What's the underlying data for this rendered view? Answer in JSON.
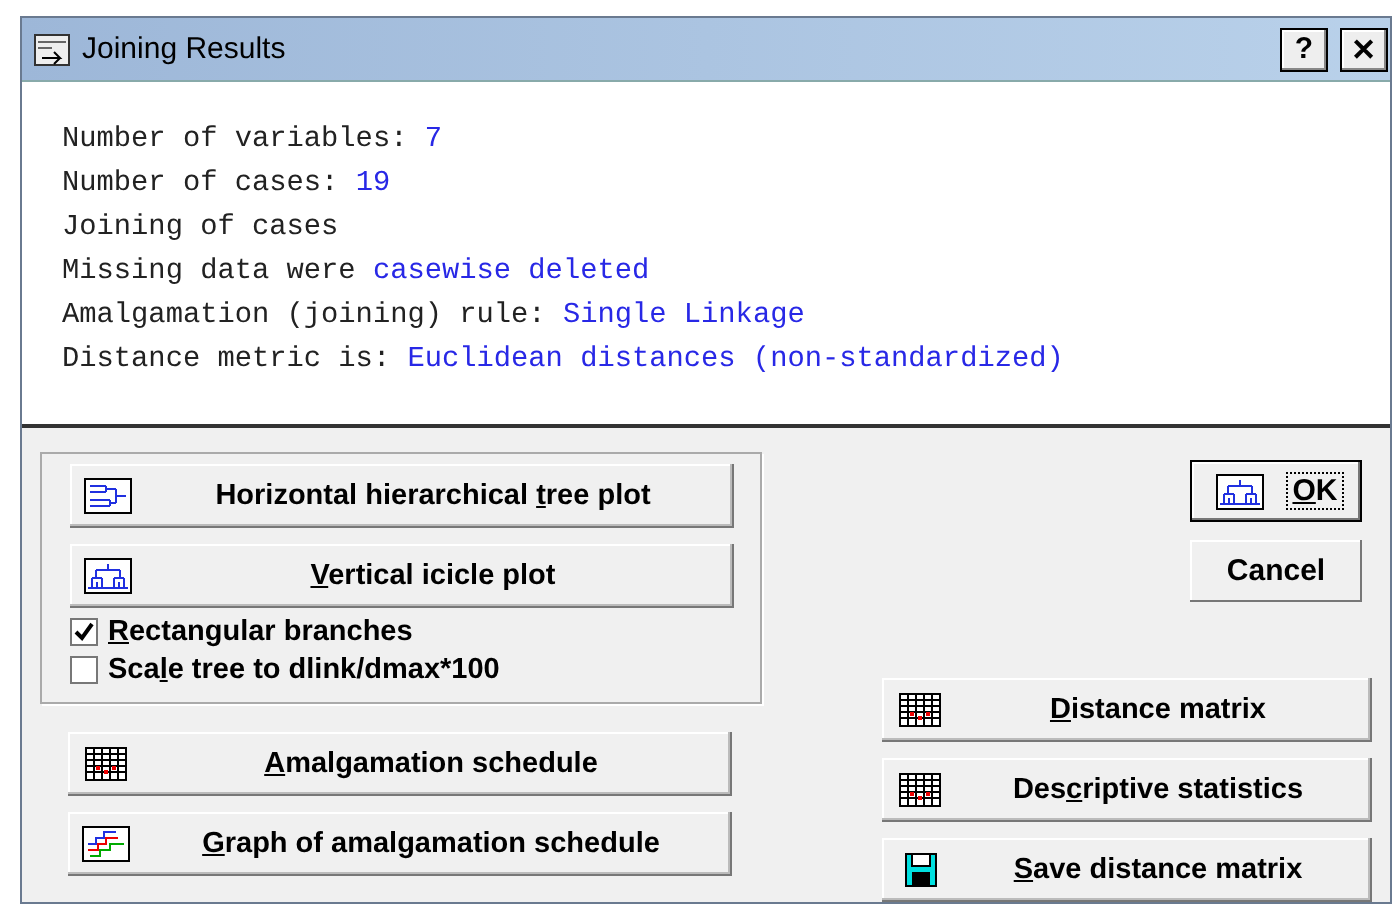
{
  "window": {
    "title": "Joining Results",
    "help_button": "?",
    "close_button": "✕"
  },
  "summary": [
    {
      "label": "Number of variables: ",
      "value": "7"
    },
    {
      "label": "Number of cases: ",
      "value": "19"
    },
    {
      "label": "Joining of cases"
    },
    {
      "label": "Missing data were ",
      "value": "casewise deleted"
    },
    {
      "label": "Amalgamation (joining) rule: ",
      "value": "Single Linkage"
    },
    {
      "label": "Distance metric is: ",
      "value": "Euclidean distances (non-standardized)"
    }
  ],
  "plot_group": {
    "buttons": [
      {
        "kind": "htree",
        "before": "Horizontal hierarchical ",
        "key": "t",
        "after": "ree plot"
      },
      {
        "kind": "vtree",
        "key": "V",
        "after": "ertical icicle plot"
      }
    ],
    "options": [
      {
        "key": "R",
        "after": "ectangular branches",
        "checked": true
      },
      {
        "before": "Sca",
        "key": "l",
        "after": "e tree to dlink/dmax*100",
        "checked": false
      }
    ]
  },
  "left_buttons": [
    {
      "kind": "grid",
      "key": "A",
      "after": "malgamation schedule"
    },
    {
      "kind": "graph",
      "key": "G",
      "after": "raph of amalgamation schedule"
    }
  ],
  "dialog_buttons": [
    {
      "kind": "vtree",
      "key": "O",
      "after": "K",
      "default": true
    },
    {
      "before": "Cancel",
      "default": false
    }
  ],
  "right_buttons": [
    {
      "kind": "grid",
      "key": "D",
      "after": "istance matrix"
    },
    {
      "kind": "grid",
      "before": "Des",
      "key": "c",
      "after": "riptive statistics"
    },
    {
      "kind": "disk",
      "key": "S",
      "after": "ave distance matrix"
    }
  ]
}
